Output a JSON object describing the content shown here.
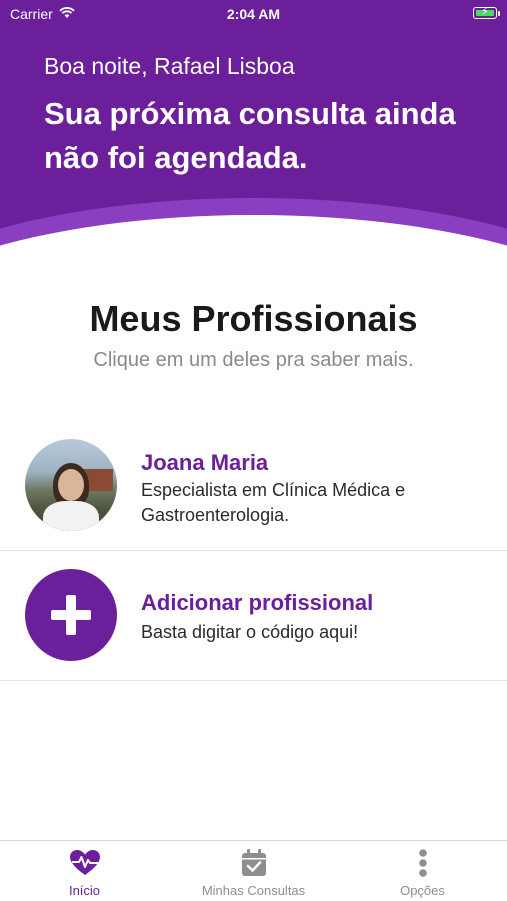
{
  "status_bar": {
    "carrier": "Carrier",
    "time": "2:04 AM"
  },
  "header": {
    "greeting": "Boa noite, Rafael Lisboa",
    "headline": "Sua próxima consulta ainda não foi agendada."
  },
  "section": {
    "title": "Meus Profissionais",
    "subtitle": "Clique em um deles pra saber mais."
  },
  "professionals": [
    {
      "name": "Joana Maria",
      "description": "Especialista em Clínica Médica e Gastroenterologia."
    }
  ],
  "add_professional": {
    "title": "Adicionar profissional",
    "description": "Basta digitar o código aqui!"
  },
  "tabs": [
    {
      "label": "Início",
      "icon": "heart-pulse-icon",
      "active": true
    },
    {
      "label": "Minhas Consultas",
      "icon": "calendar-check-icon",
      "active": false
    },
    {
      "label": "Opções",
      "icon": "vertical-dots-icon",
      "active": false
    }
  ],
  "colors": {
    "primary": "#6b1f9a",
    "primary_light": "#8a3fc0",
    "inactive": "#8e8e8e"
  }
}
